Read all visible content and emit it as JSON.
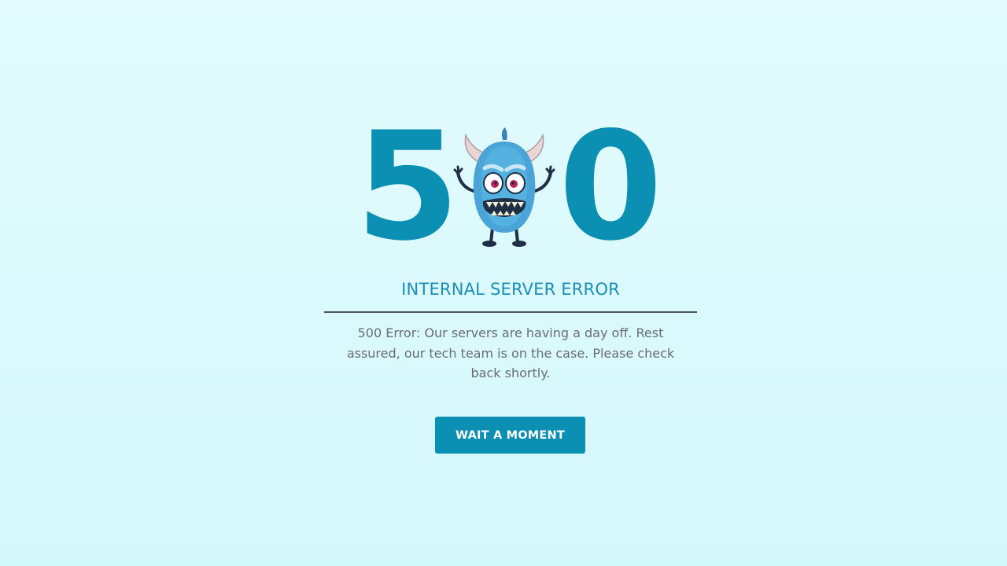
{
  "hero": {
    "digit_left": "5",
    "digit_right": "0",
    "mascot": "monster-mascot"
  },
  "title": "INTERNAL SERVER ERROR",
  "message": "500 Error: Our servers are having a day off. Rest assured, our tech team is on the case. Please check back shortly.",
  "button": {
    "label": "WAIT A MOMENT"
  },
  "colors": {
    "accent": "#0b8fb2",
    "background": "#dbf9fc",
    "text": "#6a6d70",
    "divider": "#4e5458"
  }
}
